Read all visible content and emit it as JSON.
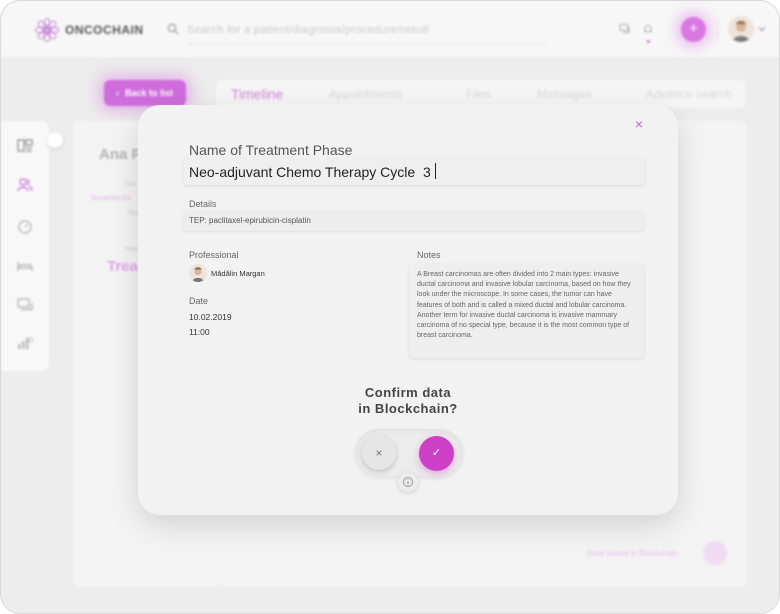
{
  "app": {
    "name": "ONCOCHAIN",
    "accent_color": "#cc3fc6"
  },
  "search": {
    "placeholder": "Search for a patient/diagnosis/procedure/result"
  },
  "header": {
    "add_label": "+",
    "icons": [
      "chat-icon",
      "bell-icon",
      "plus-icon",
      "avatar",
      "chevron-down-icon"
    ]
  },
  "nav": {
    "back_label": "Back to list",
    "tabs": [
      {
        "label": "Timeline",
        "active": true
      },
      {
        "label": "Appointments",
        "active": false
      },
      {
        "label": "Files",
        "active": false
      },
      {
        "label": "Messages",
        "active": false
      },
      {
        "label": "Advance search",
        "active": false
      }
    ]
  },
  "sidebar": {
    "icons": [
      "dashboard-icon",
      "patients-icon",
      "timer-icon",
      "bed-icon",
      "messages-icon",
      "stats-icon"
    ]
  },
  "patient_card": {
    "name": "Ana P",
    "diag_label": "Dia",
    "diagnosis": "Scuamos Ce",
    "stage_label": "Sta",
    "head_label": "Hea",
    "treatment": "Trea"
  },
  "footer": {
    "stored_text": "Data stored in Blockchain"
  },
  "modal": {
    "close_label": "×",
    "phase_label": "Name of  Treatment Phase",
    "phase_value": "Neo-adjuvant Chemo Therapy Cycle  3",
    "details_label": "Details",
    "details_value": "TEP: paclitaxel-epirubicin-cisplatin",
    "professional_label": "Professional",
    "professional_name": "Mădălin Margan",
    "date_label": "Date",
    "date_value": "10.02.2019",
    "time_value": "11:00",
    "notes_label": "Notes",
    "notes_value": "A Breast carcinomas are often divided into 2 main types: invasive ductal carcinoma and invasive lobular carcinoma, based on how they look under the microscope. In some cases, the tumor can have features of both and is called a mixed ductal and lobular carcinoma. Another term for invasive ductal carcinoma is invasive mammary carcinoma of no special type, because it is  the most common type of breast carcinoma.",
    "confirm_line1": "Confirm data",
    "confirm_line2": "in Blockchain?",
    "reject_label": "×",
    "confirm_label": "✓"
  }
}
